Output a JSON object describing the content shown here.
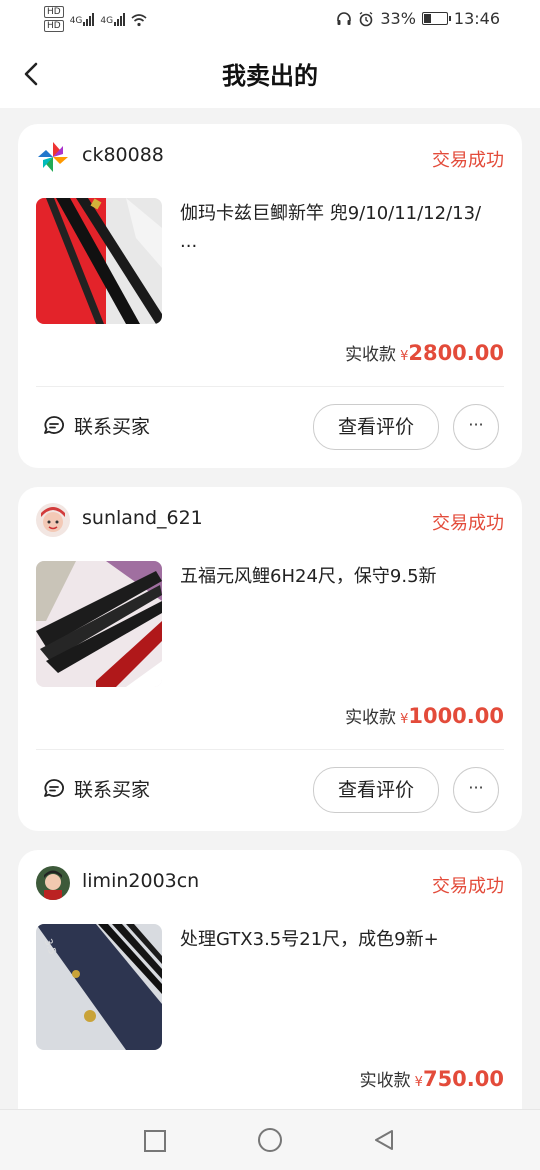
{
  "status_bar": {
    "hd1": "HD",
    "hd2": "HD",
    "net1": "4G",
    "net2": "4G",
    "battery_percent": "33%",
    "battery_level": 0.33,
    "time": "13:46"
  },
  "nav": {
    "title": "我卖出的"
  },
  "orders": [
    {
      "username": "ck80088",
      "status": "交易成功",
      "description": "伽玛卡兹巨鲫新竿 兜9/10/11/12/13/\n...",
      "price_label": "实收款",
      "currency": "¥",
      "amount": "2800.00",
      "contact_label": "联系买家",
      "review_label": "查看评价",
      "more_label": "···"
    },
    {
      "username": "sunland_621",
      "status": "交易成功",
      "description": "五福元风鲤6H24尺，保守9.5新",
      "price_label": "实收款",
      "currency": "¥",
      "amount": "1000.00",
      "contact_label": "联系买家",
      "review_label": "查看评价",
      "more_label": "···"
    },
    {
      "username": "limin2003cn",
      "status": "交易成功",
      "description": "处理GTX3.5号21尺，成色9新+",
      "price_label": "实收款",
      "currency": "¥",
      "amount": "750.00"
    }
  ],
  "colors": {
    "accent": "#e34b3a",
    "background": "#f3f3f3"
  }
}
